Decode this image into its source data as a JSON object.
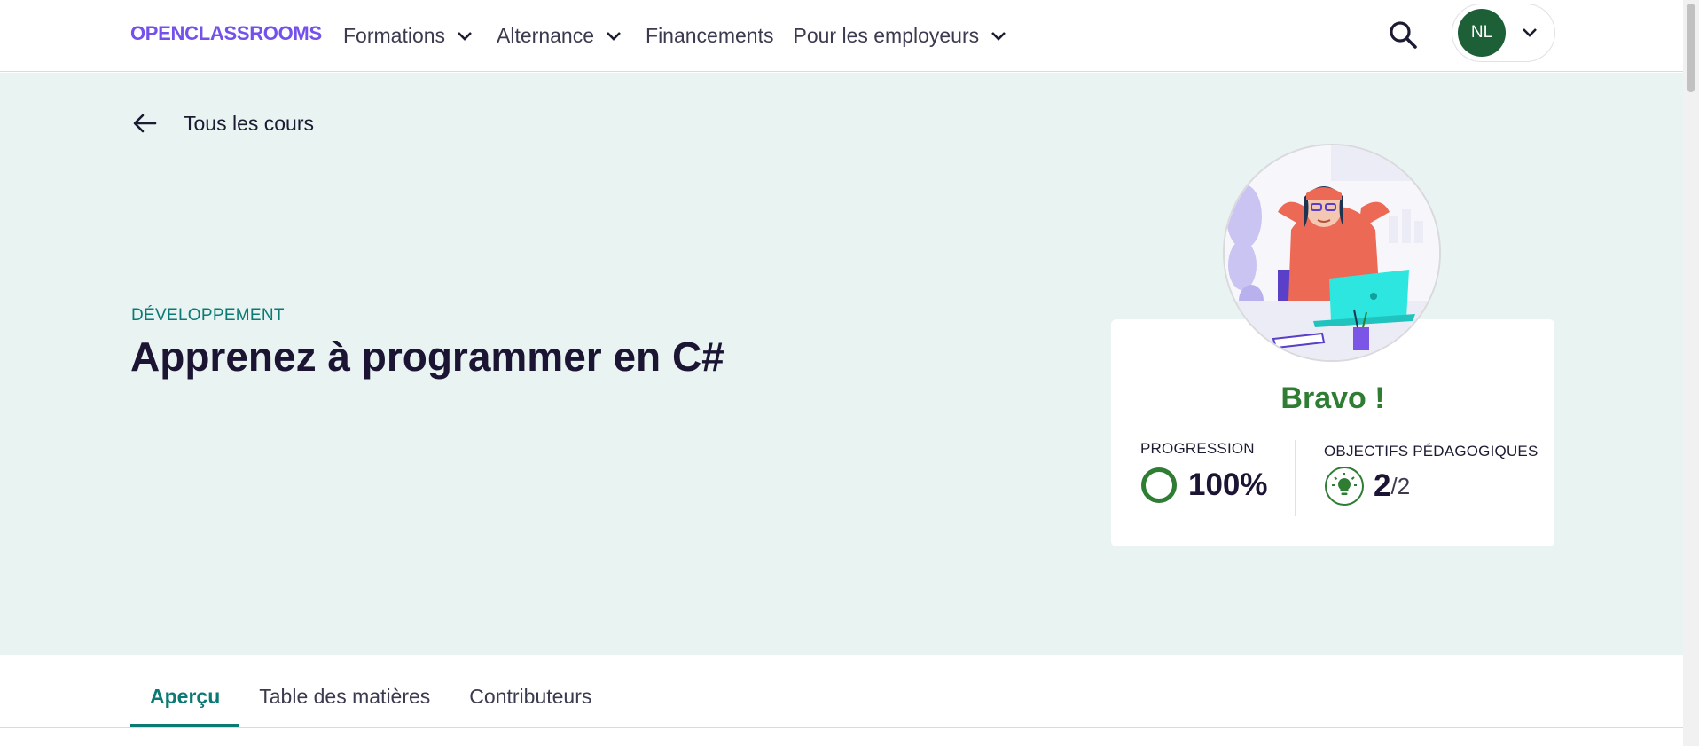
{
  "header": {
    "logo_text": "OPENCLASSROOMS",
    "nav": [
      {
        "label": "Formations",
        "has_dropdown": true
      },
      {
        "label": "Alternance",
        "has_dropdown": true
      },
      {
        "label": "Financements",
        "has_dropdown": false
      },
      {
        "label": "Pour les employeurs",
        "has_dropdown": true
      }
    ],
    "search_icon": "search-icon",
    "user_initials": "NL"
  },
  "hero": {
    "back_label": "Tous les cours",
    "category": "DÉVELOPPEMENT",
    "title": "Apprenez à programmer en C#",
    "background_color": "#e8f3f2"
  },
  "progress_card": {
    "congrats": "Bravo !",
    "progression_label": "PROGRESSION",
    "progression_value": "100%",
    "progression_fraction": 1.0,
    "objectives_label": "OBJECTIFS PÉDAGOGIQUES",
    "objectives_done": "2",
    "objectives_total": "/2",
    "accent_color": "#2e7d32"
  },
  "tabs": [
    {
      "label": "Aperçu",
      "active": true
    },
    {
      "label": "Table des matières",
      "active": false
    },
    {
      "label": "Contributeurs",
      "active": false
    }
  ],
  "colors": {
    "brand": "#7451eb",
    "teal": "#0b7a75",
    "avatar": "#1d5f37"
  }
}
